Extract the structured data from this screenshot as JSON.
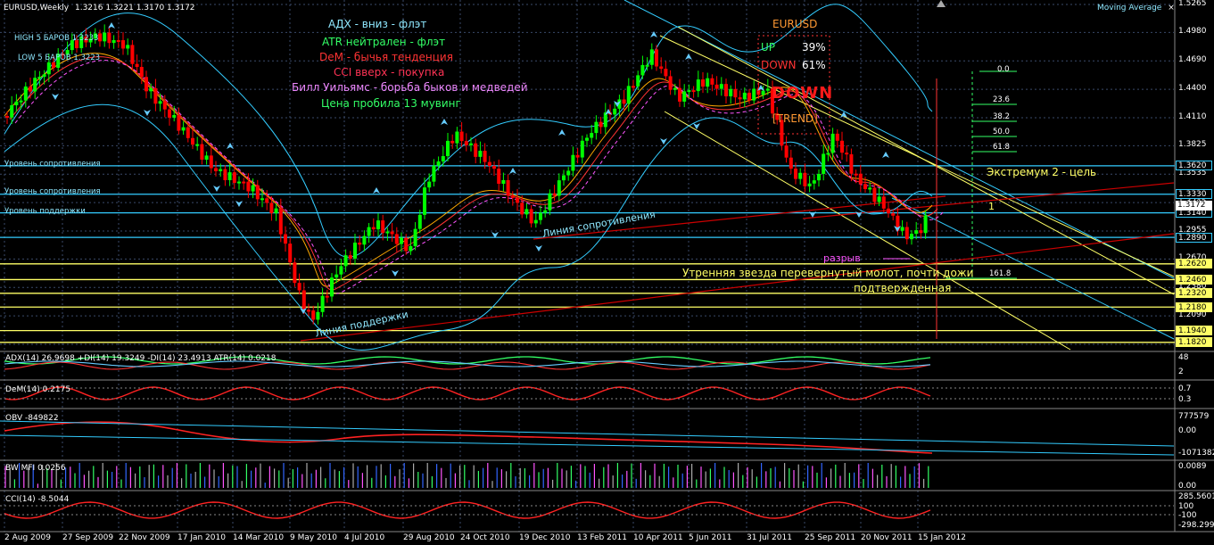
{
  "header": {
    "symbol": "EURUSD,Weekly",
    "ohlc": "1.3216 1.3221 1.3170 1.3172",
    "high5": "HIGH 5 БАРОВ 1.3233",
    "low5": "LOW 5 БАРОВ 1.3223",
    "indicator_name": "Moving Average",
    "arrow_icon": "triangle-up-icon",
    "close_icon": "close-icon"
  },
  "commentary": [
    {
      "text": "АДХ - вниз - флэт",
      "color": "#8fe8ff"
    },
    {
      "text": "ATR нейтрален - флэт",
      "color": "#33ff66"
    },
    {
      "text": "DeM - бычья тенденция",
      "color": "#ff3333"
    },
    {
      "text": "CCI вверх - покупка",
      "color": "#ff3355"
    },
    {
      "text": "Билл Уильямс - борьба быков и медведей",
      "color": "#ee88ff"
    },
    {
      "text": "Цена пробила 13 мувинг",
      "color": "#33ff66"
    }
  ],
  "trend_panel": {
    "symbol": "EURUSD",
    "up_label": "UP",
    "up_value": "39%",
    "down_label": "DOWN",
    "down_value": "61%",
    "big_word": "DOWN",
    "trend_label": "[TREND]"
  },
  "annotations": {
    "resistance_line": "Линия сопротивления",
    "support_line": "Линия поддержки",
    "extremum": "Экстремум 2 - цель",
    "gap": "разрыв",
    "morning_star": "Утренняя звезда перевернутый молот, почти дожи",
    "confirmed": "подтвержденная",
    "one_mark": "1"
  },
  "levels": {
    "resistance1": "Уровень сопротивления",
    "resistance2": "Уровень сопротивления",
    "support": "Уровень поддержки"
  },
  "fibo": [
    "0.0",
    "23.6",
    "38.2",
    "50.0",
    "61.8",
    "161.8"
  ],
  "price_axis": [
    "1.5265",
    "1.4980",
    "1.4690",
    "1.4400",
    "1.4110",
    "1.3825",
    "1.3535",
    "1.3245",
    "1.2955",
    "1.2670",
    "1.2380",
    "1.2090",
    "1.1800"
  ],
  "price_boxes": [
    {
      "value": "1.3620",
      "bg": "#000000",
      "fg": "#ffffff",
      "bd": "#33ccff"
    },
    {
      "value": "1.3330",
      "bg": "#000000",
      "fg": "#ffffff",
      "bd": "#33ccff"
    },
    {
      "value": "1.3140",
      "bg": "#000000",
      "fg": "#ffffff",
      "bd": "#33ccff"
    },
    {
      "value": "1.2890",
      "bg": "#000000",
      "fg": "#ffffff",
      "bd": "#33ccff"
    },
    {
      "value": "1.2620",
      "bg": "#ffff66",
      "fg": "#000000",
      "bd": "#ffff66"
    },
    {
      "value": "1.2460",
      "bg": "#ffff66",
      "fg": "#000000",
      "bd": "#ffff66"
    },
    {
      "value": "1.2320",
      "bg": "#ffff66",
      "fg": "#000000",
      "bd": "#ffff66"
    },
    {
      "value": "1.2180",
      "bg": "#ffff66",
      "fg": "#000000",
      "bd": "#ffff66"
    },
    {
      "value": "1.1940",
      "bg": "#ffff66",
      "fg": "#000000",
      "bd": "#ffff66"
    },
    {
      "value": "1.1820",
      "bg": "#ffff66",
      "fg": "#000000",
      "bd": "#ffff66"
    }
  ],
  "current_price": "1.3172",
  "indicators": {
    "adx": {
      "title": "ADX(14) 26.9698 +DI(14) 19.3249 -DI(14) 23.4913 ATR(14) 0.0218",
      "axis": [
        "48",
        "2"
      ]
    },
    "dem": {
      "title": "DeM(14) 0.2175",
      "axis": [
        "0.7",
        "0.3"
      ]
    },
    "obv": {
      "title": "OBV -849822",
      "axis": [
        "777579",
        "0.00",
        "-1071382"
      ]
    },
    "mfi": {
      "title": "BW MFI 0.0256",
      "axis": [
        "0.0089",
        "0.00"
      ]
    },
    "cci": {
      "title": "CCI(14) -8.5044",
      "axis": [
        "285.5601",
        "100",
        "-100",
        "-298.299"
      ]
    }
  },
  "dates": [
    "2 Aug 2009",
    "27 Sep 2009",
    "22 Nov 2009",
    "17 Jan 2010",
    "14 Mar 2010",
    "9 May 2010",
    "4 Jul 2010",
    "29 Aug 2010",
    "24 Oct 2010",
    "19 Dec 2010",
    "13 Feb 2011",
    "10 Apr 2011",
    "5 Jun 2011",
    "31 Jul 2011",
    "25 Sep 2011",
    "20 Nov 2011",
    "15 Jan 2012"
  ],
  "colors": {
    "bull": "#00ff00",
    "bear": "#ff0000",
    "level": "#33ccff",
    "fibo_level": "#ffff66",
    "grid": "#3a4a6a"
  }
}
